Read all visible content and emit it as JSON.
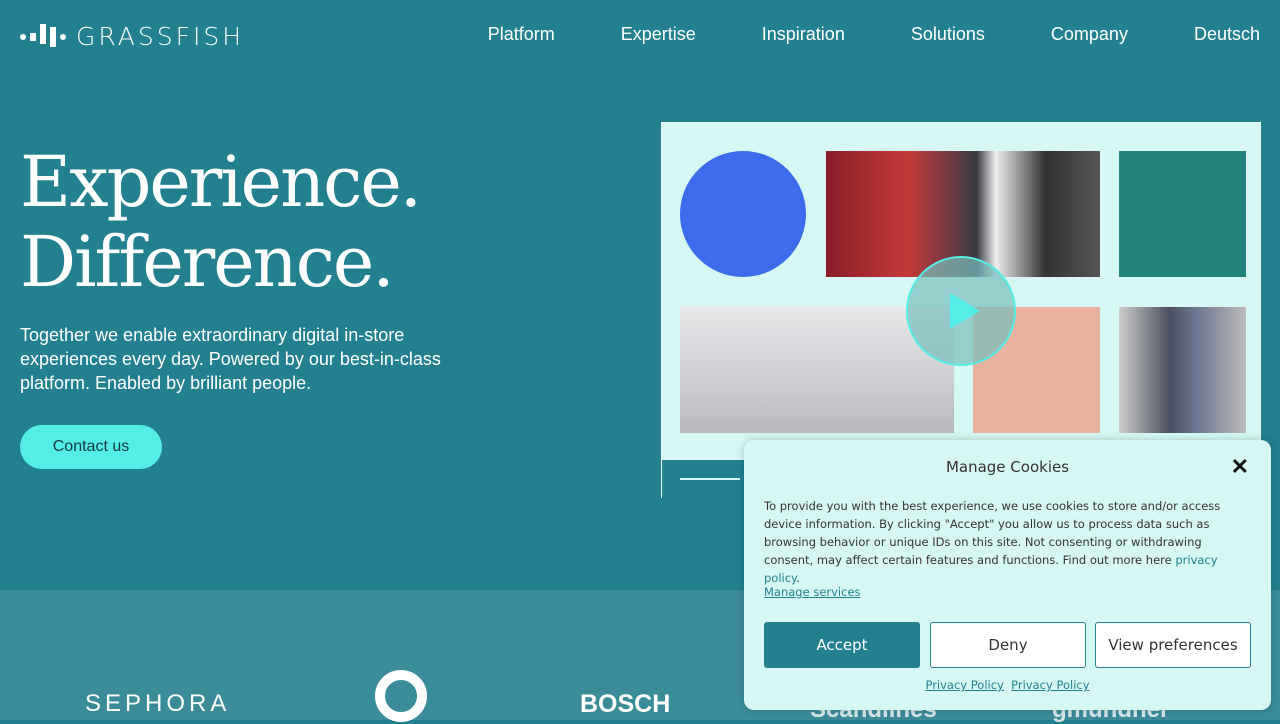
{
  "brand": {
    "name": "GRASSFISH"
  },
  "nav": [
    "Platform",
    "Expertise",
    "Inspiration",
    "Solutions",
    "Company",
    "Deutsch"
  ],
  "hero": {
    "line1": "Experience.",
    "line2": "Difference.",
    "lead": "Together we enable extraordinary digital in-store experiences every day. Powered by our best-in-class platform. Enabled by brilliant people.",
    "cta": "Contact us"
  },
  "logos": [
    "SEPHORA",
    "BOSCH",
    "Scandlines",
    "gmundner"
  ],
  "cookie": {
    "title": "Manage Cookies",
    "body": "To provide you with the best experience, we use cookies to store and/or access device information. By clicking \"Accept\" you allow us to process data such as browsing behavior or unique IDs on this site. Not consenting or withdrawing consent, may affect certain features and functions. Find out more here ",
    "policy_link": "privacy policy",
    "manage": "Manage services",
    "accept": "Accept",
    "deny": "Deny",
    "prefs": "View preferences",
    "pp1": "Privacy Policy",
    "pp2": "Privacy Policy"
  },
  "colors": {
    "bg": "#22808f",
    "accent": "#54eee6",
    "panel": "#d6f7f4"
  }
}
